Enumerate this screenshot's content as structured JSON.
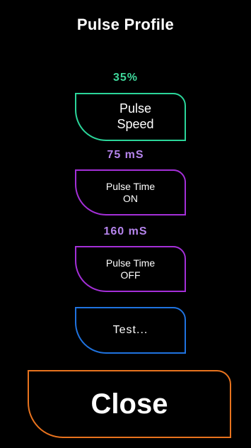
{
  "title": "Pulse Profile",
  "pulse_speed": {
    "value": "35%",
    "label": "Pulse\nSpeed",
    "value_color": "#3fd89b",
    "border_color": "#2bd69a"
  },
  "pulse_time_on": {
    "value": "75 mS",
    "label": "Pulse Time\nON",
    "value_color": "#b584ec",
    "border_color": "#a42fd8"
  },
  "pulse_time_off": {
    "value": "160 mS",
    "label": "Pulse Time\nOFF",
    "value_color": "#b584ec",
    "border_color": "#a42fd8"
  },
  "test": {
    "label": "Test...",
    "border_color": "#1f73e0"
  },
  "close": {
    "label": "Close",
    "border_color": "#e8731e"
  }
}
